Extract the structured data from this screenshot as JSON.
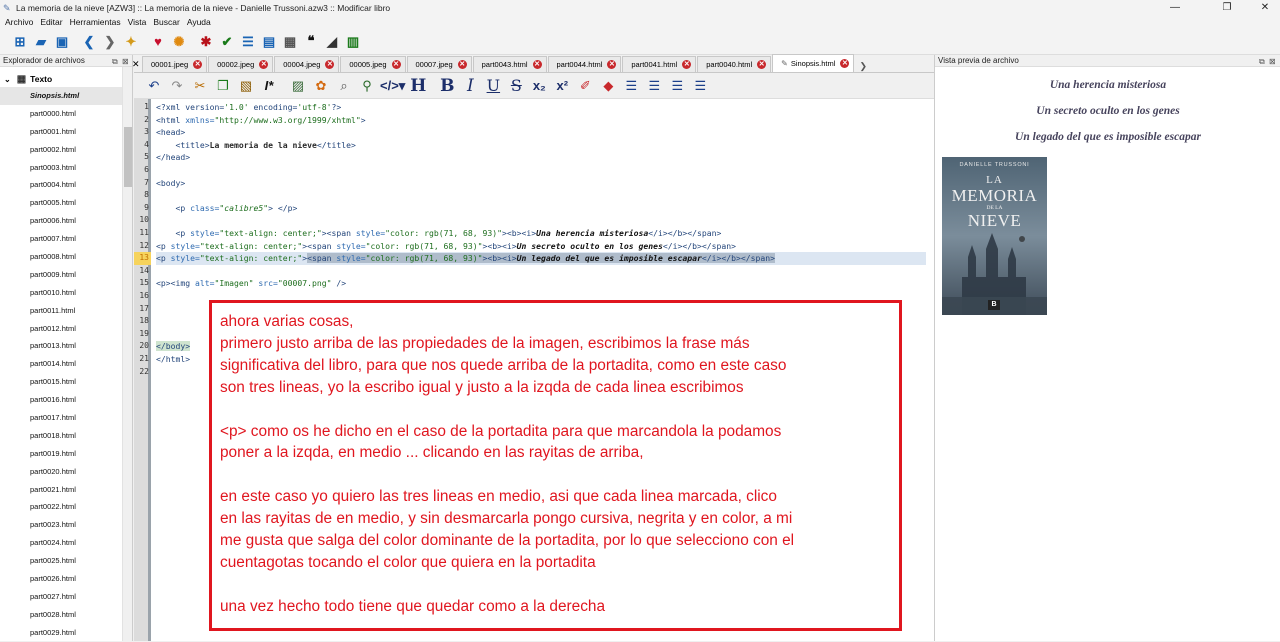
{
  "window": {
    "title": "La memoria de la nieve [AZW3] :: La memoria de la nieve - Danielle Trussoni.azw3 :: Modificar libro",
    "minimize": "—",
    "maximize": "❐",
    "close": "✕"
  },
  "menu": [
    "Archivo",
    "Editar",
    "Herramientas",
    "Vista",
    "Buscar",
    "Ayuda"
  ],
  "left_panel": {
    "title": "Explorador de archivos",
    "root": "Texto",
    "files": [
      "Sinopsis.html",
      "part0000.html",
      "part0001.html",
      "part0002.html",
      "part0003.html",
      "part0004.html",
      "part0005.html",
      "part0006.html",
      "part0007.html",
      "part0008.html",
      "part0009.html",
      "part0010.html",
      "part0011.html",
      "part0012.html",
      "part0013.html",
      "part0014.html",
      "part0015.html",
      "part0016.html",
      "part0017.html",
      "part0018.html",
      "part0019.html",
      "part0020.html",
      "part0021.html",
      "part0022.html",
      "part0023.html",
      "part0024.html",
      "part0025.html",
      "part0026.html",
      "part0027.html",
      "part0028.html",
      "part0029.html"
    ]
  },
  "tabs": [
    {
      "label": "00001.jpeg"
    },
    {
      "label": "00002.jpeg"
    },
    {
      "label": "00004.jpeg"
    },
    {
      "label": "00005.jpeg"
    },
    {
      "label": "00007.jpeg"
    },
    {
      "label": "part0043.html"
    },
    {
      "label": "part0044.html"
    },
    {
      "label": "part0041.html"
    },
    {
      "label": "part0040.html"
    },
    {
      "label": "Sinopsis.html"
    }
  ],
  "editor": {
    "line_numbers": [
      "1",
      "2",
      "3",
      "4",
      "5",
      "6",
      "7",
      "8",
      "9",
      "10",
      "11",
      "12",
      "13",
      "14",
      "15",
      "16",
      "17",
      "18",
      "19",
      "20",
      "21",
      "22"
    ],
    "current_line": 13
  },
  "right_panel": {
    "title": "Vista previa de archivo",
    "lines": [
      "Una herencia misteriosa",
      "Un secreto oculto en los genes",
      "Un legado del que es imposible escapar"
    ],
    "cover": {
      "author": "DANIELLE TRUSSONI",
      "title_1": "LA",
      "title_2": "MEMORIA",
      "title_3": "DE LA",
      "title_4": "NIEVE",
      "publisher": "B"
    }
  },
  "annotation": {
    "lines": [
      "ahora varias cosas,",
      "primero justo arriba de las propiedades de la imagen, escribimos la frase más",
      "significativa del libro, para que nos quede arriba de la portadita, como en este caso",
      "son tres lineas, yo la escribo igual y justo a la izqda de cada linea escribimos",
      "",
      "<p> como os he dicho en el caso de la portadita para que marcandola la podamos",
      "poner a la izqda, en medio ... clicando en las rayitas de arriba,",
      "",
      "en este caso yo quiero las tres lineas en medio, asi que cada linea marcada, clico",
      "en las rayitas de en medio, y sin desmarcarla pongo cursiva, negrita y en color, a mi",
      "me gusta que salga del color dominante de la portadita, por lo que selecciono con el",
      "cuentagotas tocando el color que quiera en la portadita",
      "",
      "una vez hecho todo tiene que quedar como a la derecha"
    ]
  },
  "colors": {
    "accent_red": "#e0161f",
    "preview_text": "#47445d",
    "tab_close": "#c8282c"
  }
}
